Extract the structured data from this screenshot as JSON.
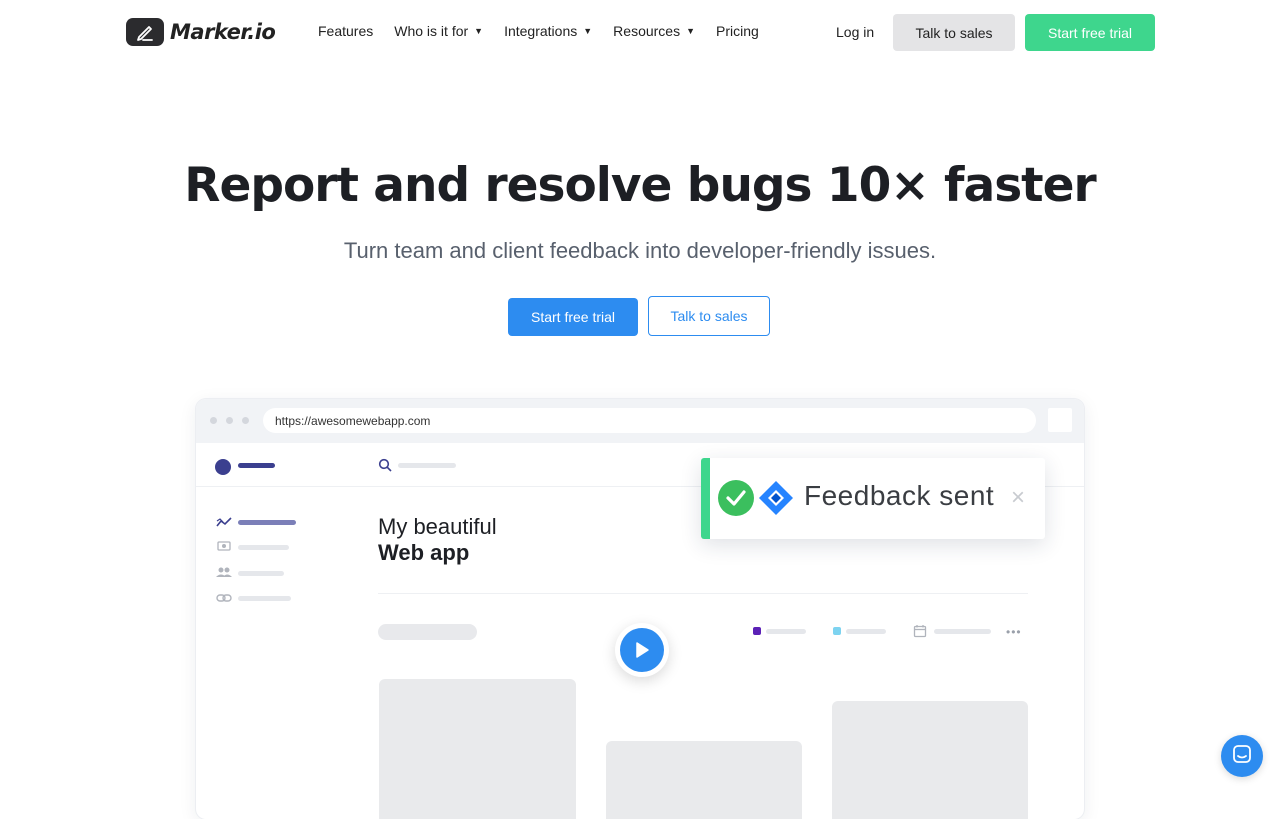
{
  "brand": {
    "name": "Marker.io"
  },
  "nav": {
    "items": [
      {
        "label": "Features",
        "dropdown": false
      },
      {
        "label": "Who is it for",
        "dropdown": true
      },
      {
        "label": "Integrations",
        "dropdown": true
      },
      {
        "label": "Resources",
        "dropdown": true
      },
      {
        "label": "Pricing",
        "dropdown": false
      }
    ],
    "login": "Log in",
    "talk_to_sales": "Talk to sales",
    "start_trial": "Start free trial"
  },
  "hero": {
    "title": "Report and resolve bugs 10× faster",
    "subtitle": "Turn team and client feedback into developer-friendly issues.",
    "primary_cta": "Start free trial",
    "secondary_cta": "Talk to sales"
  },
  "mockup": {
    "url": "https://awesomewebapp.com",
    "title_line1": "My beautiful",
    "title_line2": "Web app"
  },
  "toast": {
    "message": "Feedback sent",
    "close_symbol": "×"
  },
  "colors": {
    "green_accent": "#3ed68d",
    "blue_accent": "#2d8cf0",
    "dark_navy": "#3b3f8f",
    "legend_purple": "#5b21b6",
    "legend_cyan": "#7dd3f0"
  }
}
